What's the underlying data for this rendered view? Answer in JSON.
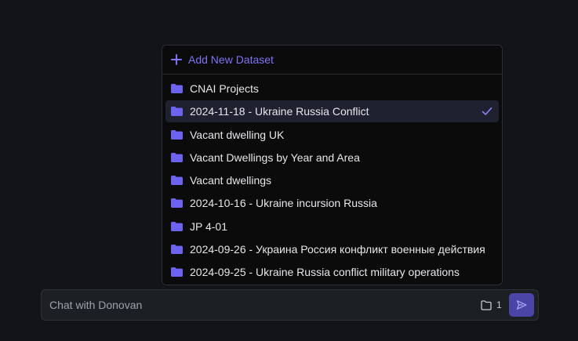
{
  "dataset_menu": {
    "add_label": "Add New Dataset",
    "items": [
      {
        "label": "CNAI Projects",
        "selected": false
      },
      {
        "label": "2024-11-18 - Ukraine Russia Conflict",
        "selected": true
      },
      {
        "label": "Vacant dwelling UK",
        "selected": false
      },
      {
        "label": "Vacant Dwellings by Year and Area",
        "selected": false
      },
      {
        "label": "Vacant dwellings",
        "selected": false
      },
      {
        "label": "2024-10-16 - Ukraine incursion Russia",
        "selected": false
      },
      {
        "label": "JP 4-01",
        "selected": false
      },
      {
        "label": "2024-09-26 - Украина Россия конфликт военные действия",
        "selected": false
      },
      {
        "label": "2024-09-25 - Ukraine Russia conflict military operations",
        "selected": false
      }
    ]
  },
  "chat": {
    "placeholder": "Chat with Donovan",
    "dataset_count": "1"
  },
  "colors": {
    "accent": "#7d74f5",
    "folder": "#6c63f0",
    "send_button": "#4b45a8",
    "selected_row": "#1f2030",
    "background": "#121417"
  },
  "icons": {
    "add": "plus-icon",
    "folder": "folder-icon",
    "selected": "check-icon",
    "dataset_count": "folder-outline-icon",
    "send": "send-icon"
  }
}
